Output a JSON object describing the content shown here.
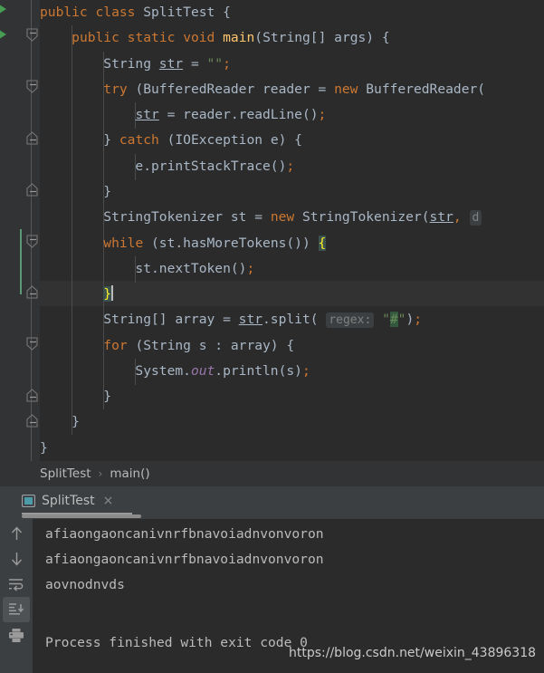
{
  "editor": {
    "language": "java",
    "file_class": "SplitTest",
    "lines": [
      {
        "n": 1,
        "indent": 0,
        "text": "public class SplitTest {"
      },
      {
        "n": 2,
        "indent": 1,
        "text": "public static void main(String[] args) {"
      },
      {
        "n": 3,
        "indent": 2,
        "text": "String str = \"\";"
      },
      {
        "n": 4,
        "indent": 2,
        "text": "try (BufferedReader reader = new BufferedReader("
      },
      {
        "n": 5,
        "indent": 3,
        "text": "str = reader.readLine();"
      },
      {
        "n": 6,
        "indent": 2,
        "text": "} catch (IOException e) {"
      },
      {
        "n": 7,
        "indent": 3,
        "text": "e.printStackTrace();"
      },
      {
        "n": 8,
        "indent": 2,
        "text": "}"
      },
      {
        "n": 9,
        "indent": 2,
        "text": "StringTokenizer st = new StringTokenizer(str, d"
      },
      {
        "n": 10,
        "indent": 2,
        "text": "while (st.hasMoreTokens()) {"
      },
      {
        "n": 11,
        "indent": 3,
        "text": "st.nextToken();"
      },
      {
        "n": 12,
        "indent": 2,
        "text": "}"
      },
      {
        "n": 13,
        "indent": 2,
        "text": "String[] array = str.split( regex: \"#\");"
      },
      {
        "n": 14,
        "indent": 2,
        "text": "for (String s : array) {"
      },
      {
        "n": 15,
        "indent": 3,
        "text": "System.out.println(s);"
      },
      {
        "n": 16,
        "indent": 2,
        "text": "}"
      },
      {
        "n": 17,
        "indent": 1,
        "text": "}"
      },
      {
        "n": 18,
        "indent": 0,
        "text": "}"
      }
    ],
    "param_hints": [
      {
        "label": "regex:",
        "line": 13
      },
      {
        "label": "d",
        "line": 9
      }
    ],
    "caret_line": 12,
    "matched_braces": [
      "{",
      "}"
    ],
    "search_highlight": "#"
  },
  "breadcrumb": {
    "items": [
      "SplitTest",
      "main()"
    ],
    "separator": "›"
  },
  "run_window": {
    "tab_label": "SplitTest",
    "tab_close": "×",
    "toolbar": [
      {
        "name": "up-arrow-icon",
        "title": "Up the stack trace",
        "selected": false
      },
      {
        "name": "down-arrow-icon",
        "title": "Down the stack trace",
        "selected": false
      },
      {
        "name": "soft-wrap-icon",
        "title": "Soft-Wrap",
        "selected": false
      },
      {
        "name": "scroll-to-end-icon",
        "title": "Scroll to the end",
        "selected": true
      },
      {
        "name": "print-icon",
        "title": "Print",
        "selected": false
      }
    ],
    "console_output": [
      "afiaongaoncanivnrfbnavoiadnvonvoron",
      "afiaongaoncanivnrfbnavoiadnvonvoron",
      "aovnodnvds",
      "",
      "Process finished with exit code 0"
    ]
  },
  "watermark": {
    "text": "https://blog.csdn.net/weixin_43896318"
  },
  "colors": {
    "editor_bg": "#2B2B2B",
    "gutter_bg": "#313335",
    "panel_bg": "#3C3F41",
    "default_text": "#A9B7C6",
    "keyword": "#CC7832",
    "string": "#6A8759",
    "static_field": "#9876AA",
    "number": "#6897BB",
    "run_arrow_green": "#499C54",
    "change_bar": "#5B9A78",
    "brace_match_bg": "#3B514D",
    "brace_match_fg": "#FFEF28",
    "search_match_bg": "#32593D",
    "current_line_bg": "#323232",
    "console_text": "#BBBBBB"
  }
}
